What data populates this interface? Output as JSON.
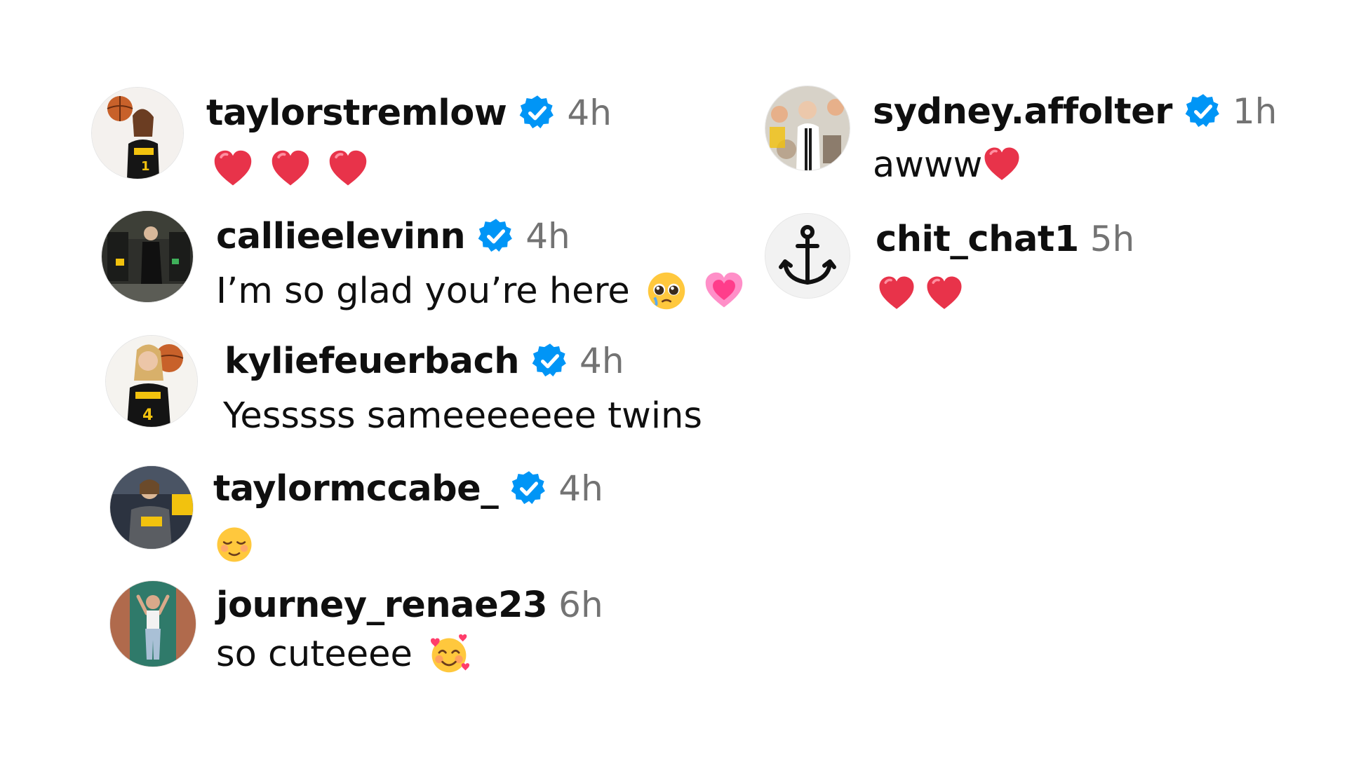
{
  "colors": {
    "verified_blue": "#0095f6",
    "timestamp_gray": "#737373",
    "heart_red": "#e8334a",
    "text": "#0f0f0f"
  },
  "comments": [
    {
      "username": "taylorstremlow",
      "verified": true,
      "time": "4h",
      "text": "",
      "emojis": [
        "red-heart",
        "red-heart",
        "red-heart"
      ],
      "avatar": "player-with-basketball-avatar"
    },
    {
      "username": "callieelevinn",
      "verified": true,
      "time": "4h",
      "text": "I’m so glad you’re here",
      "emojis": [
        "pleading-face",
        "pink-heart"
      ],
      "avatar": "locker-room-avatar"
    },
    {
      "username": "kyliefeuerbach",
      "verified": true,
      "time": "4h",
      "text": "Yesssss sameeeeeee twins",
      "emojis": [],
      "avatar": "player-holding-basketball-avatar"
    },
    {
      "username": "taylormccabe_",
      "verified": true,
      "time": "4h",
      "text": "",
      "emojis": [
        "relieved-face"
      ],
      "avatar": "arena-avatar"
    },
    {
      "username": "journey_renae23",
      "verified": false,
      "time": "6h",
      "text": "so cuteeee",
      "emojis": [
        "smiling-face-with-hearts"
      ],
      "avatar": "doorway-avatar"
    },
    {
      "username": "sydney.affolter",
      "verified": true,
      "time": "1h",
      "text": "awww",
      "emojis": [
        "red-heart"
      ],
      "avatar": "crowd-avatar"
    },
    {
      "username": "chit_chat1",
      "verified": false,
      "time": "5h",
      "text": "",
      "emojis": [
        "red-heart",
        "red-heart"
      ],
      "avatar": "anchor-avatar"
    }
  ]
}
